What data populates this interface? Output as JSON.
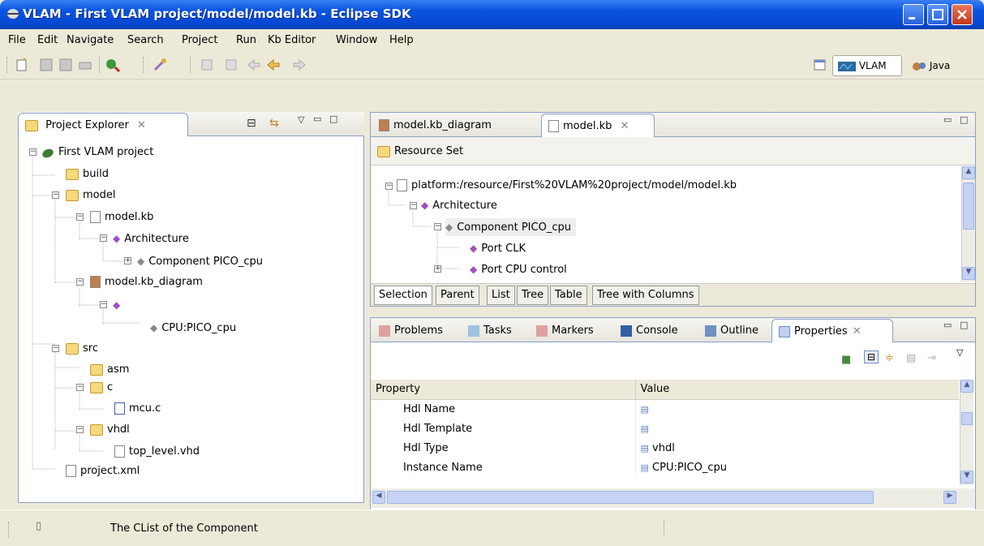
{
  "window": {
    "title": "VLAM - First VLAM project/model/model.kb - Eclipse SDK"
  },
  "menu": [
    "File",
    "Edit",
    "Navigate",
    "Search",
    "Project",
    "Run",
    "Kb Editor",
    "Window",
    "Help"
  ],
  "perspectives": {
    "vlam": "VLAM",
    "java": "Java"
  },
  "project_explorer": {
    "title": "Project Explorer",
    "tree": [
      "First VLAM project",
      "build",
      "model",
      "model.kb",
      "Architecture",
      "Component PICO_cpu",
      "model.kb_diagram",
      "",
      "CPU:PICO_cpu",
      "src",
      "asm",
      "c",
      "mcu.c",
      "vhdl",
      "top_level.vhd",
      "project.xml"
    ]
  },
  "editor": {
    "tabs": [
      "model.kb_diagram",
      "model.kb"
    ],
    "resource_set": "Resource Set",
    "tree": [
      "platform:/resource/First%20VLAM%20project/model/model.kb",
      "Architecture",
      "Component PICO_cpu",
      "Port CLK",
      "Port CPU control"
    ],
    "bottom_tabs": [
      "Selection",
      "Parent",
      "List",
      "Tree",
      "Table",
      "Tree with Columns"
    ]
  },
  "views": {
    "tabs": [
      "Problems",
      "Tasks",
      "Markers",
      "Console",
      "Outline",
      "Properties"
    ],
    "columns": [
      "Property",
      "Value"
    ],
    "rows": [
      {
        "property": "Hdl Name",
        "value": ""
      },
      {
        "property": "Hdl Template",
        "value": ""
      },
      {
        "property": "Hdl Type",
        "value": "vhdl"
      },
      {
        "property": "Instance Name",
        "value": "CPU:PICO_cpu"
      }
    ]
  },
  "status": {
    "message": "The CList of the Component"
  }
}
